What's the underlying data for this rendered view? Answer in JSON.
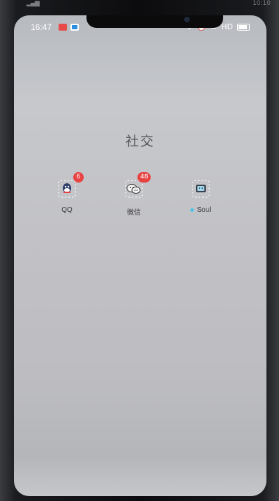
{
  "outer_status": {
    "time": "10:10"
  },
  "status_bar": {
    "time": "16:47",
    "network": "HD"
  },
  "folder": {
    "title": "社交"
  },
  "apps": [
    {
      "label": "QQ",
      "badge": "6"
    },
    {
      "label": "微信",
      "badge": "48"
    },
    {
      "label": "Soul"
    }
  ],
  "colors": {
    "badge": "#e84343",
    "soul_dot": "#4dc3e8",
    "title": "#555659"
  }
}
